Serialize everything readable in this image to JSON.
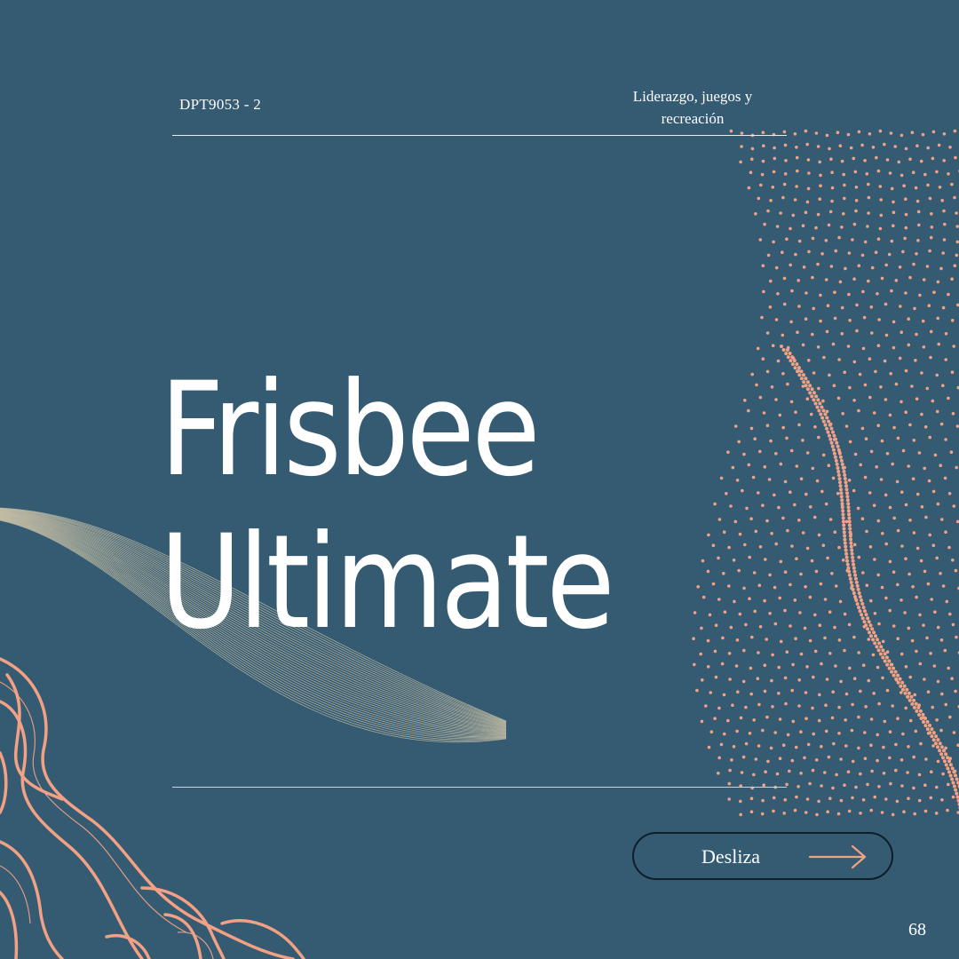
{
  "header": {
    "course_code": "DPT9053 - 2",
    "subject_line1": "Liderazgo, juegos y",
    "subject_line2": "recreación"
  },
  "title": {
    "line1": "Frisbee",
    "line2": "Ultimate"
  },
  "cta": {
    "label": "Desliza",
    "icon": "arrow-right-icon"
  },
  "footer": {
    "page_number": "68"
  },
  "colors": {
    "background": "#355b72",
    "accent_salmon": "#f2a185",
    "wave_lines": "#d2c7aa",
    "text": "#ffffff"
  }
}
